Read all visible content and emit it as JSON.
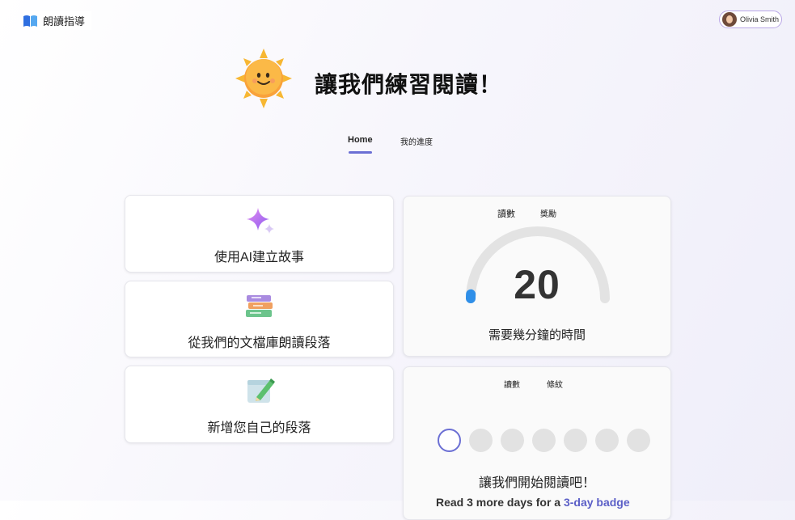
{
  "app": {
    "title": "朗讀指導"
  },
  "user": {
    "name": "Olivia Smith"
  },
  "hero": {
    "title": "讓我們練習閱讀！"
  },
  "tabs": [
    {
      "label": "Home",
      "active": true
    },
    {
      "label": "我的進度",
      "active": false
    }
  ],
  "cards": [
    {
      "label": "使用AI建立故事",
      "icon": "sparkle-icon"
    },
    {
      "label": "從我們的文檔庫朗讀段落",
      "icon": "books-icon"
    },
    {
      "label": "新增您自己的段落",
      "icon": "notebook-pencil-icon"
    }
  ],
  "gauge": {
    "left_label": "讀數",
    "right_label": "獎勵",
    "value": "20",
    "caption": "需要幾分鐘的時間",
    "progress_fraction": 0.02
  },
  "streak": {
    "left_label": "讀數",
    "right_label": "條紋",
    "days": [
      true,
      false,
      false,
      false,
      false,
      false,
      false
    ],
    "message": "讓我們開始閱讀吧！",
    "sub_prefix": "Read 3 more days for a ",
    "sub_link": "3-day badge"
  },
  "colors": {
    "accent": "#6b6fd4",
    "gauge_track": "#e3e3e3",
    "gauge_fill": "#2f8fe8"
  }
}
